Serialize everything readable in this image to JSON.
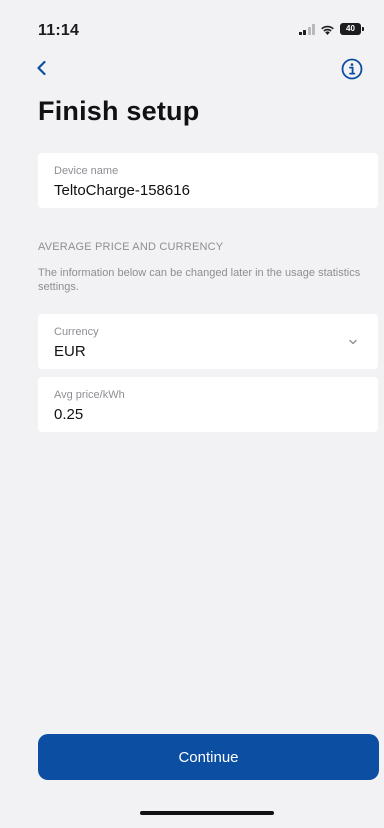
{
  "status_bar": {
    "time": "11:14",
    "battery_level": "40",
    "signal_icon": "cellular-signal-icon",
    "wifi_icon": "wifi-icon"
  },
  "nav": {
    "back_icon": "chevron-left-icon",
    "info_icon": "info-circle-icon"
  },
  "page": {
    "title": "Finish setup"
  },
  "device": {
    "label": "Device name",
    "value": "TeltoCharge-158616"
  },
  "pricing": {
    "section_title": "AVERAGE PRICE AND CURRENCY",
    "description": "The information below can be changed later in the usage statistics settings.",
    "currency_label": "Currency",
    "currency_value": "EUR",
    "currency_icon": "chevron-down-icon",
    "price_label": "Avg price/kWh",
    "price_value": "0.25"
  },
  "actions": {
    "continue_label": "Continue"
  },
  "colors": {
    "accent": "#0b4ea2",
    "background": "#f2f2f4",
    "card": "#ffffff",
    "muted_text": "#8e8e93"
  }
}
